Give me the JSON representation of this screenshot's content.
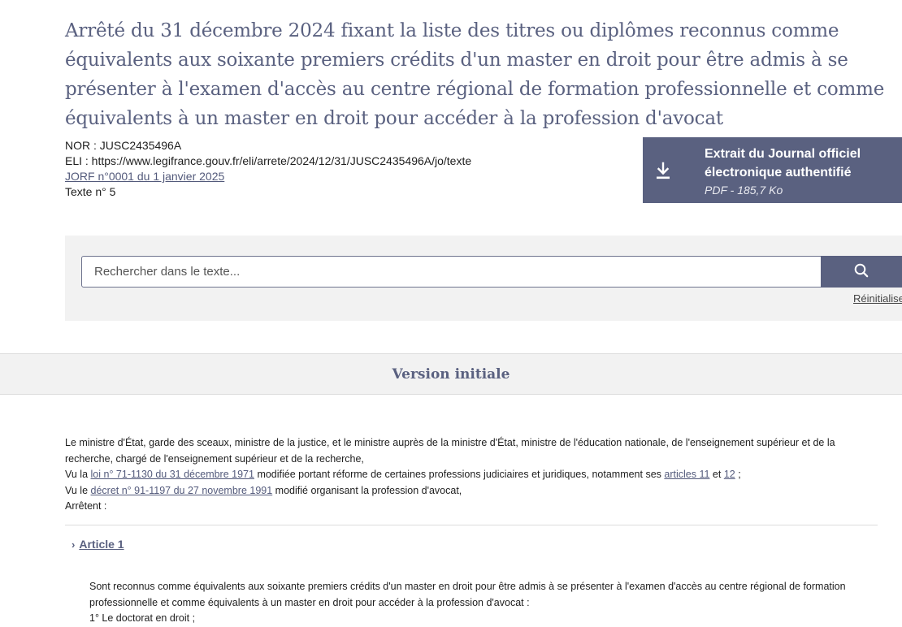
{
  "header": {
    "title": "Arrêté du 31 décembre 2024 fixant la liste des titres ou diplômes reconnus comme équivalents aux soixante premiers crédits d'un master en droit pour être admis à se présenter à l'examen d'accès au centre régional de formation professionnelle et comme équivalents à un master en droit pour accéder à la profession d'avocat",
    "nor": "NOR : JUSC2435496A",
    "eli": "ELI : https://www.legifrance.gouv.fr/eli/arrete/2024/12/31/JUSC2435496A/jo/texte",
    "jorf_link": "JORF n°0001 du 1 janvier 2025",
    "texte_num": "Texte n° 5"
  },
  "pdf": {
    "icon": "download-icon",
    "title_line1": "Extrait du Journal officiel",
    "title_line2": "électronique authentifié",
    "size": "PDF - 185,7 Ko"
  },
  "search": {
    "placeholder": "Rechercher dans le texte...",
    "button_icon": "search-icon",
    "reset_label": "Réinitialiser"
  },
  "version": {
    "label": "Version initiale"
  },
  "preamble": {
    "minister": "Le ministre d'État, garde des sceaux, ministre de la justice, et le ministre auprès de la ministre d'État, ministre de l'éducation nationale, de l'enseignement supérieur et de la recherche, chargé de l'enseignement supérieur et de la recherche,",
    "vu1_prefix": "Vu la ",
    "vu1_link": "loi n° 71-1130 du 31 décembre 1971",
    "vu1_mid": " modifiée portant réforme de certaines professions judiciaires et juridiques, notamment ses ",
    "vu1_link2": "articles 11",
    "vu1_and": " et ",
    "vu1_link3": "12",
    "vu1_end": " ;",
    "vu2_prefix": "Vu le ",
    "vu2_link": "décret n° 91-1197 du 27 novembre 1991",
    "vu2_end": " modifié organisant la profession d'avocat,",
    "arretent": "Arrêtent :"
  },
  "article1": {
    "chevron": "›",
    "title": "Article 1",
    "text1": "Sont reconnus comme équivalents aux soixante premiers crédits d'un master en droit pour être admis à se présenter à l'examen d'accès au centre régional de formation professionnelle et comme équivalents à un master en droit pour accéder à la profession d'avocat :",
    "item1": "1° Le doctorat en droit ;"
  }
}
